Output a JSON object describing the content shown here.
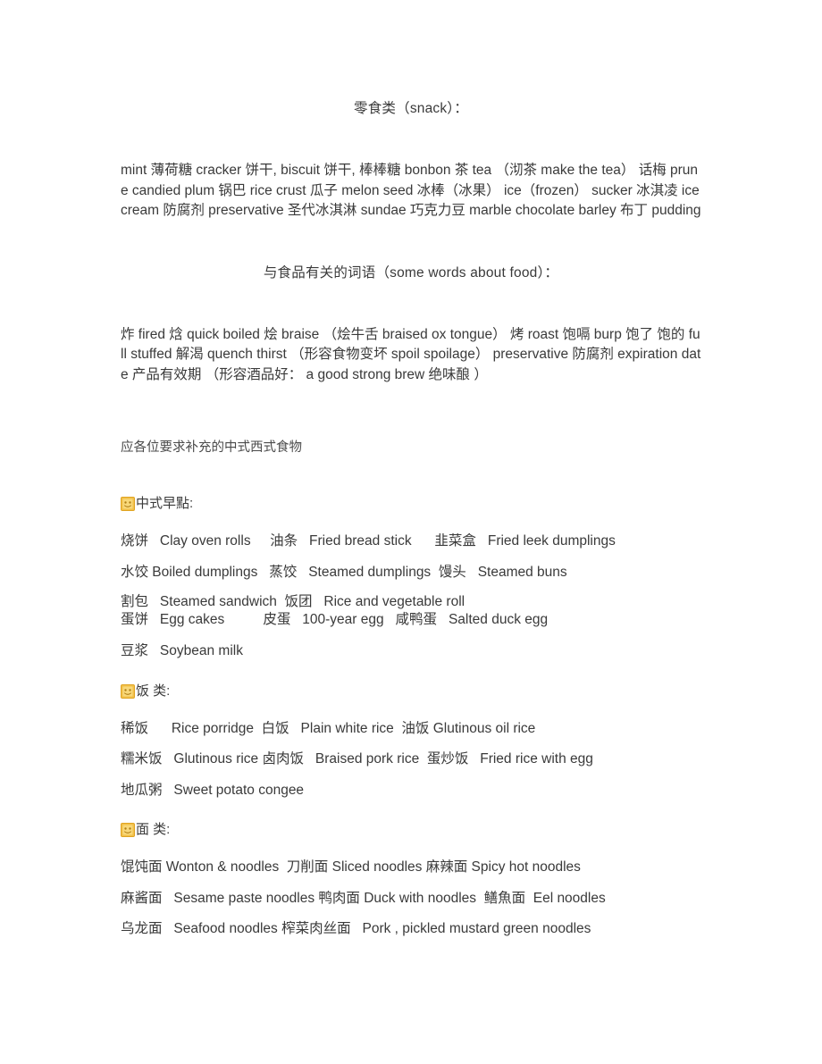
{
  "document": {
    "section_snack": {
      "heading": "零食类（snack）：",
      "body": "mint 薄荷糖 cracker 饼干, biscuit 饼干, 棒棒糖 bonbon 茶 tea （沏茶 make the tea） 话梅 prune candied plum 锅巴 rice crust 瓜子 melon seed 冰棒（冰果） ice（frozen） sucker 冰淇凌 ice cream 防腐剂 preservative 圣代冰淇淋 sundae 巧克力豆 marble chocolate barley 布丁 pudding"
    },
    "section_food_words": {
      "heading": "与食品有关的词语（some words about food）：",
      "body": "炸 fired 焓 quick boiled 烩 braise （烩牛舌 braised ox tongue） 烤 roast 饱嗝 burp 饱了 饱的 full stuffed 解渴 quench thirst （形容食物变坏 spoil spoilage） preservative 防腐剂 expiration date 产品有效期 （形容酒品好： a good strong brew 绝味酿 ）"
    },
    "section_added": {
      "title": "应各位要求补充的中式西式食物",
      "categories": [
        {
          "icon": "orange-emoji-icon",
          "label": "中式早點:",
          "groups": [
            {
              "tight": false,
              "lines": [
                "烧饼   Clay oven rolls     油条   Fried bread stick      韭菜盒   Fried leek dumplings",
                "水饺 Boiled dumplings   蒸饺   Steamed dumplings  馒头   Steamed buns"
              ]
            },
            {
              "tight": true,
              "lines": [
                "割包   Steamed sandwich  饭团   Rice and vegetable roll",
                "蛋饼   Egg cakes          皮蛋   100-year egg   咸鸭蛋   Salted duck egg"
              ]
            },
            {
              "tight": false,
              "lines": [
                "豆浆   Soybean milk"
              ]
            }
          ]
        },
        {
          "icon": "orange-emoji-icon",
          "label": "饭 类:",
          "groups": [
            {
              "tight": false,
              "lines": [
                "稀饭      Rice porridge  白饭   Plain white rice  油饭 Glutinous oil rice",
                "糯米饭   Glutinous rice 卤肉饭   Braised pork rice  蛋炒饭   Fried rice with egg",
                "地瓜粥   Sweet potato congee"
              ]
            }
          ]
        },
        {
          "icon": "orange-emoji-icon",
          "label": "面 类:",
          "groups": [
            {
              "tight": false,
              "lines": [
                "馄饨面 Wonton & noodles  刀削面 Sliced noodles 麻辣面 Spicy hot noodles",
                "麻酱面   Sesame paste noodles 鸭肉面 Duck with noodles  鳝魚面  Eel noodles",
                "乌龙面   Seafood noodles 榨菜肉丝面   Pork , pickled mustard green noodles"
              ]
            }
          ]
        }
      ]
    }
  }
}
